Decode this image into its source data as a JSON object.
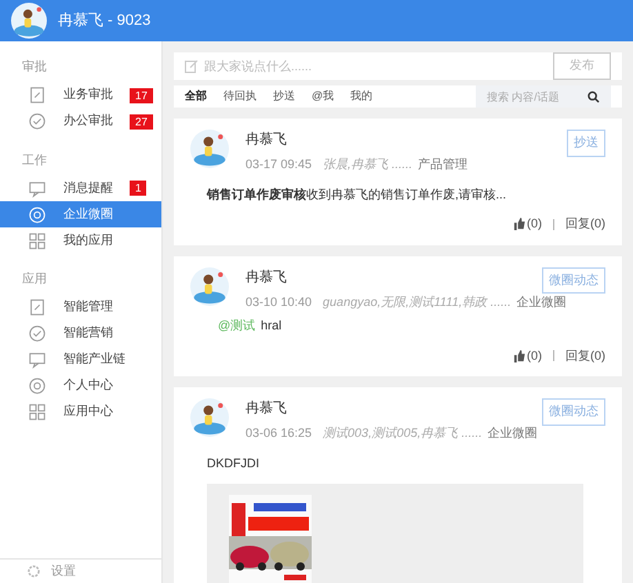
{
  "header": {
    "title": "冉慕飞 - 9023"
  },
  "sidebar": {
    "sections": [
      {
        "label": "审批",
        "items": [
          {
            "label": "业务审批",
            "badge": "17",
            "selected": false
          },
          {
            "label": "办公审批",
            "badge": "27",
            "selected": false
          }
        ]
      },
      {
        "label": "工作",
        "items": [
          {
            "label": "消息提醒",
            "badge": "1",
            "selected": false
          },
          {
            "label": "企业微圈",
            "selected": true
          },
          {
            "label": "我的应用",
            "selected": false
          }
        ]
      },
      {
        "label": "应用",
        "items": [
          {
            "label": "智能管理",
            "selected": false
          },
          {
            "label": "智能营销",
            "selected": false
          },
          {
            "label": "智能产业链",
            "selected": false
          },
          {
            "label": "个人中心",
            "selected": false
          },
          {
            "label": "应用中心",
            "selected": false
          }
        ]
      }
    ],
    "settings": "设置"
  },
  "compose": {
    "placeholder": "跟大家说点什么......",
    "button": "发布"
  },
  "filters": [
    {
      "label": "全部",
      "selected": true
    },
    {
      "label": "待回执",
      "selected": false
    },
    {
      "label": "抄送",
      "selected": false
    },
    {
      "label": "@我",
      "selected": false
    },
    {
      "label": "我的",
      "selected": false
    }
  ],
  "search": {
    "placeholder": "搜索 内容/话题"
  },
  "posts": [
    {
      "author": "冉慕飞",
      "time": "03-17 09:45",
      "recipients": "张晨,冉慕飞 ......",
      "category": "产品管理",
      "tag": "抄送",
      "title": "销售订单作废审核",
      "body": "收到冉慕飞的销售订单作废,请审核...",
      "likes": "(0)",
      "replies": "回复(0)"
    },
    {
      "author": "冉慕飞",
      "time": "03-10 10:40",
      "recipients": "guangyao,无限,测试1111,韩政 ......",
      "category": "企业微圈",
      "tag": "微圈动态",
      "mention": "@测试",
      "body": "hral",
      "likes": "(0)",
      "replies": "回复(0)"
    },
    {
      "author": "冉慕飞",
      "time": "03-06 16:25",
      "recipients": "测试003,测试005,冉慕飞 ......",
      "category": "企业微圈",
      "tag": "微圈动态",
      "body": "DKDFJDI"
    }
  ]
}
